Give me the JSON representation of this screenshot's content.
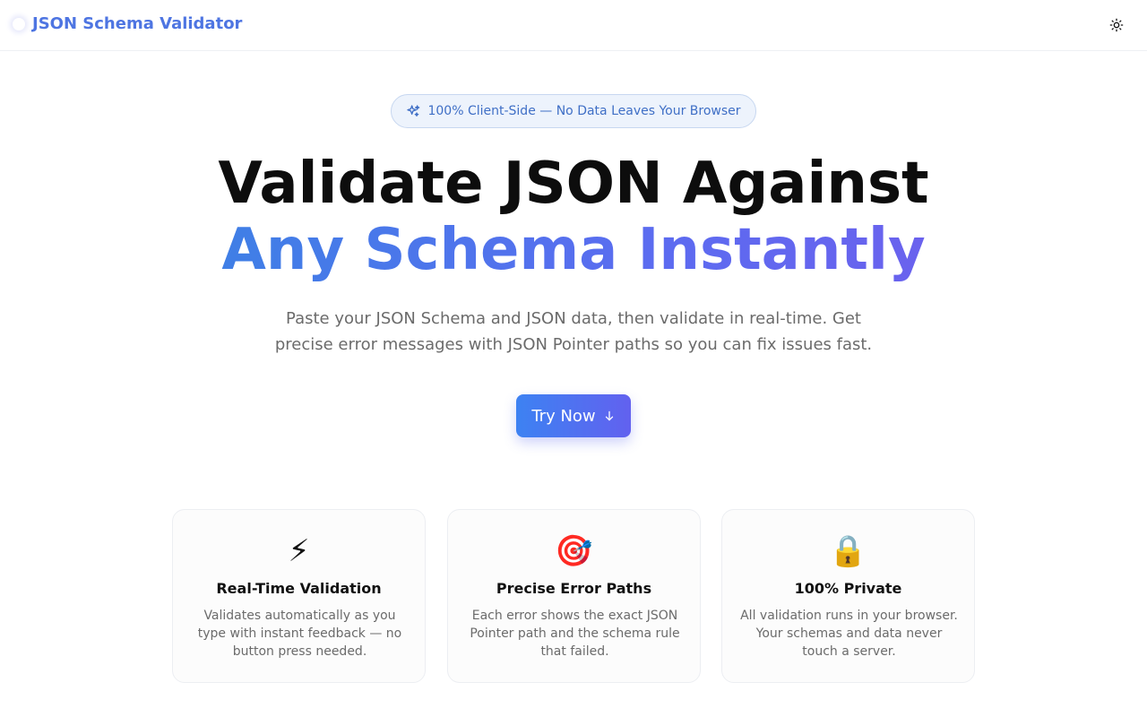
{
  "header": {
    "brand": "JSON Schema Validator",
    "theme_toggle_icon": "sun-icon"
  },
  "hero": {
    "badge_icon": "sparkles-icon",
    "badge_text": "100% Client-Side — No Data Leaves Your Browser",
    "headline_line1": "Validate JSON Against",
    "headline_line2": "Any Schema Instantly",
    "subtitle": "Paste your JSON Schema and JSON data, then validate in real-time. Get precise error messages with JSON Pointer paths so you can fix issues fast.",
    "cta_label": "Try Now",
    "cta_icon": "arrow-down-icon"
  },
  "features": [
    {
      "icon": "⚡",
      "icon_name": "lightning-icon",
      "title": "Real-Time Validation",
      "description": "Validates automatically as you type with instant feedback — no button press needed."
    },
    {
      "icon": "🎯",
      "icon_name": "target-icon",
      "title": "Precise Error Paths",
      "description": "Each error shows the exact JSON Pointer path and the schema rule that failed."
    },
    {
      "icon": "🔒",
      "icon_name": "lock-icon",
      "title": "100% Private",
      "description": "All validation runs in your browser. Your schemas and data never touch a server."
    }
  ],
  "colors": {
    "brand": "#4e75e2",
    "gradient_start": "#3d82f2",
    "gradient_end": "#6261ef",
    "badge_bg": "#edf3fc",
    "badge_text": "#3f6fc6"
  }
}
